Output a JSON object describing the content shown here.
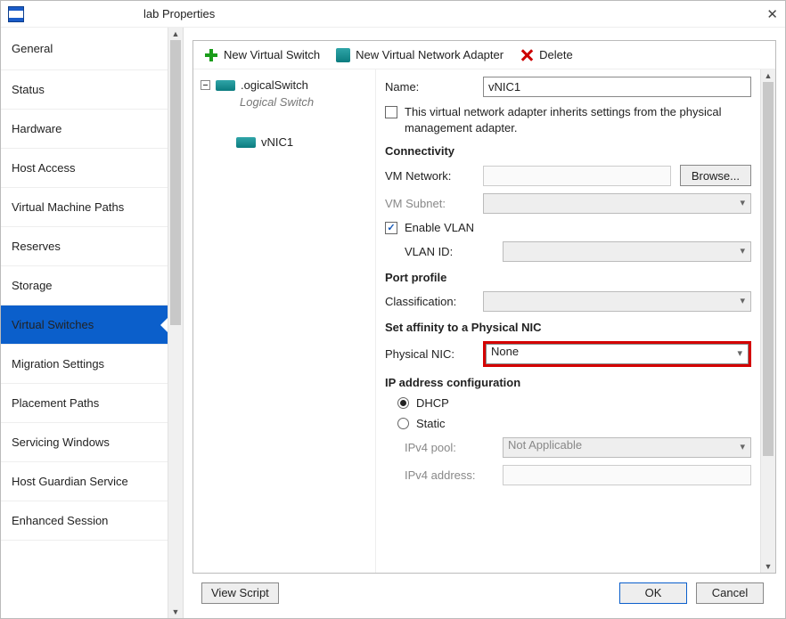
{
  "window": {
    "title": "lab Properties"
  },
  "sidebar": {
    "items": [
      "General",
      "Status",
      "Hardware",
      "Host Access",
      "Virtual Machine Paths",
      "Reserves",
      "Storage",
      "Virtual Switches",
      "Migration Settings",
      "Placement Paths",
      "Servicing Windows",
      "Host Guardian Service",
      "Enhanced Session"
    ],
    "active_index": 7
  },
  "toolbar": {
    "new_switch": "New Virtual Switch",
    "new_adapter": "New Virtual Network Adapter",
    "delete": "Delete"
  },
  "tree": {
    "switch_name": ".ogicalSwitch",
    "switch_subtitle": "Logical Switch",
    "adapter_name": "vNIC1"
  },
  "form": {
    "labels": {
      "name": "Name:",
      "inherit": "This virtual network adapter inherits settings from the physical management adapter.",
      "connectivity": "Connectivity",
      "vm_network": "VM Network:",
      "vm_subnet": "VM Subnet:",
      "enable_vlan": "Enable VLAN",
      "vlan_id": "VLAN ID:",
      "port_profile": "Port profile",
      "classification": "Classification:",
      "affinity": "Set affinity to a Physical NIC",
      "physical_nic": "Physical NIC:",
      "ip_config": "IP address configuration",
      "dhcp": "DHCP",
      "static": "Static",
      "ipv4_pool": "IPv4 pool:",
      "ipv4_address": "IPv4 address:",
      "browse": "Browse..."
    },
    "values": {
      "name": "vNIC1",
      "vm_network": "",
      "vm_subnet": "",
      "inherit_checked": false,
      "enable_vlan_checked": true,
      "vlan_id": "",
      "classification": "",
      "physical_nic": "None",
      "ip_mode": "dhcp",
      "ipv4_pool": "Not Applicable",
      "ipv4_address": ""
    }
  },
  "buttons": {
    "view_script": "View Script",
    "ok": "OK",
    "cancel": "Cancel"
  }
}
